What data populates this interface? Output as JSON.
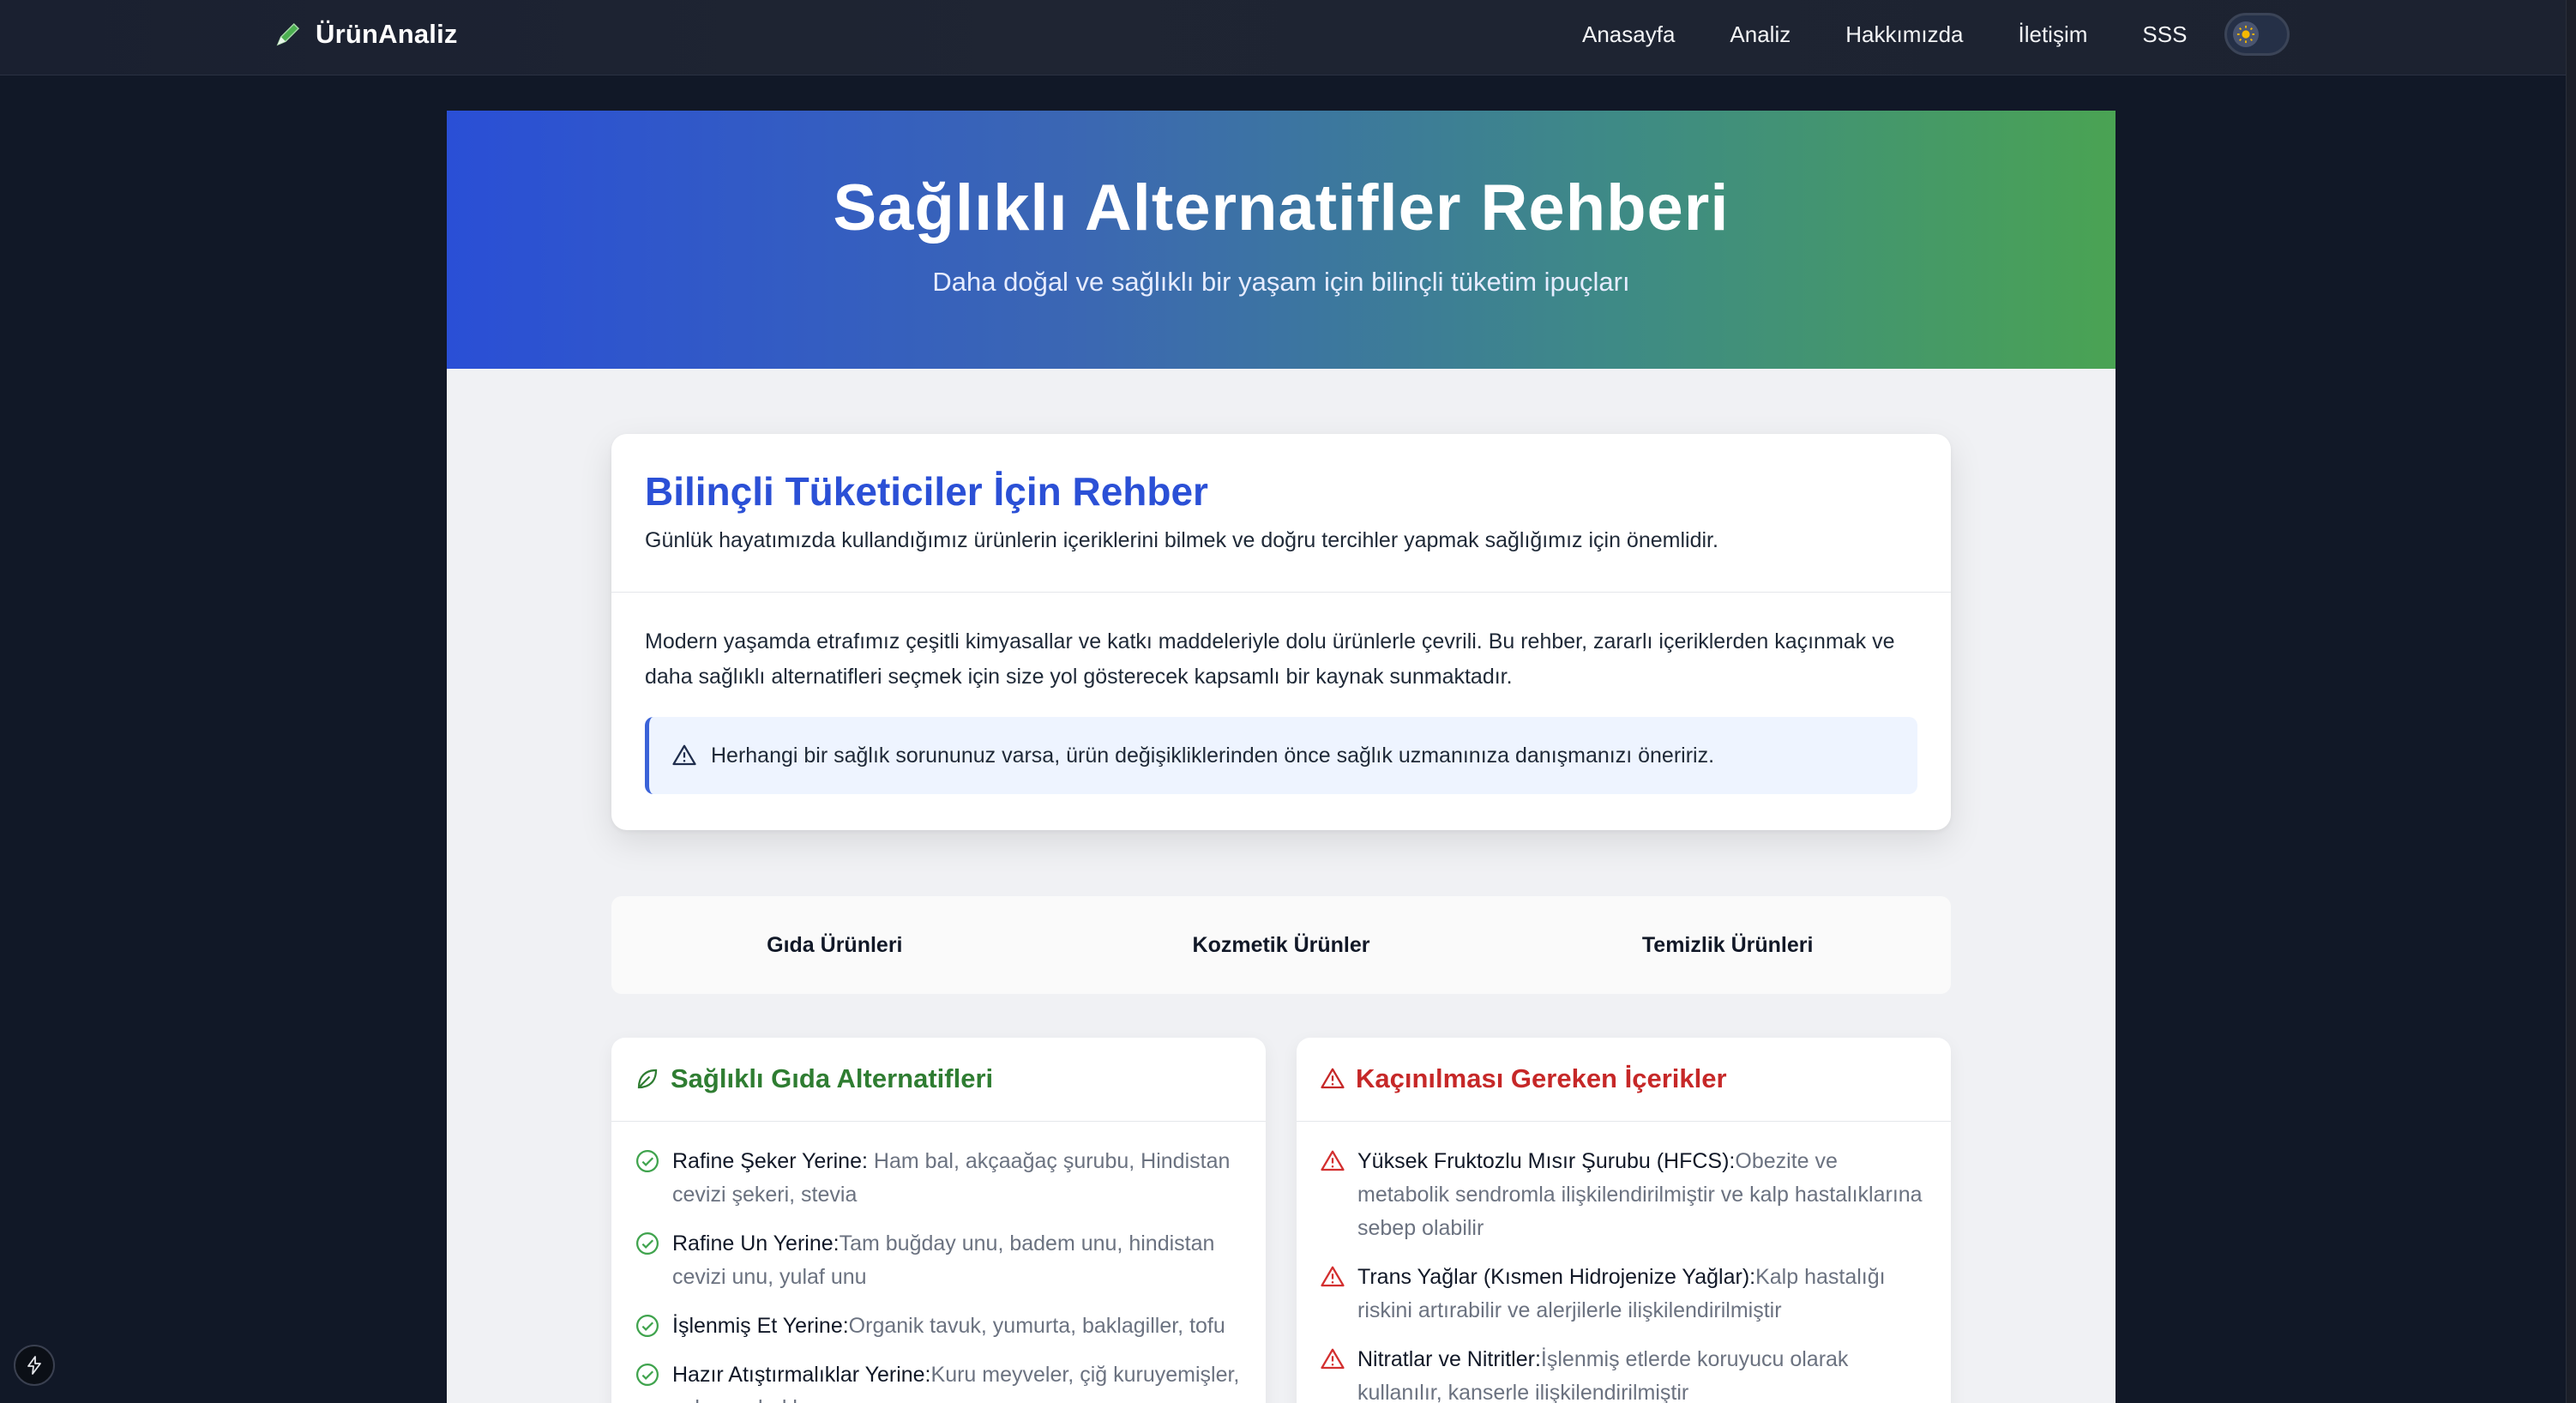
{
  "nav": {
    "brand": "ÜrünAnaliz",
    "links": [
      "Anasayfa",
      "Analiz",
      "Hakkımızda",
      "İletişim",
      "SSS"
    ],
    "brand_icon": "pencil-icon",
    "toggle_icon": "sun-icon"
  },
  "hero": {
    "title": "Sağlıklı Alternatifler Rehberi",
    "subtitle": "Daha doğal ve sağlıklı bir yaşam için bilinçli tüketim ipuçları"
  },
  "intro": {
    "title": "Bilinçli Tüketiciler İçin Rehber",
    "lead": "Günlük hayatımızda kullandığımız ürünlerin içeriklerini bilmek ve doğru tercihler yapmak sağlığımız için önemlidir.",
    "body": "Modern yaşamda etrafımız çeşitli kimyasallar ve katkı maddeleriyle dolu ürünlerle çevrili. Bu rehber, zararlı içeriklerden kaçınmak ve daha sağlıklı alternatifleri seçmek için size yol gösterecek kapsamlı bir kaynak sunmaktadır.",
    "notice": "Herhangi bir sağlık sorununuz varsa, ürün değişikliklerinden önce sağlık uzmanınıza danışmanızı öneririz."
  },
  "tabs": [
    "Gıda Ürünleri",
    "Kozmetik Ürünler",
    "Temizlik Ürünleri"
  ],
  "healthy": {
    "title": "Sağlıklı Gıda Alternatifleri",
    "items": [
      {
        "label": "Rafine Şeker Yerine:",
        "desc": " Ham bal, akçaağaç şurubu, Hindistan cevizi şekeri, stevia"
      },
      {
        "label": "Rafine Un Yerine:",
        "desc": "Tam buğday unu, badem unu, hindistan cevizi unu, yulaf unu"
      },
      {
        "label": "İşlenmiş Et Yerine:",
        "desc": "Organik tavuk, yumurta, baklagiller, tofu"
      },
      {
        "label": "Hazır Atıştırmalıklar Yerine:",
        "desc": "Kuru meyveler, çiğ kuruyemişler, sebze çubukları"
      }
    ]
  },
  "avoid": {
    "title": "Kaçınılması Gereken İçerikler",
    "items": [
      {
        "label": "Yüksek Fruktozlu Mısır Şurubu (HFCS):",
        "desc": "Obezite ve metabolik sendromla ilişkilendirilmiştir ve kalp hastalıklarına sebep olabilir"
      },
      {
        "label": "Trans Yağlar (Kısmen Hidrojenize Yağlar):",
        "desc": "Kalp hastalığı riskini artırabilir ve alerjilerle ilişkilendirilmiştir"
      },
      {
        "label": "Nitratlar ve Nitritler:",
        "desc": "İşlenmiş etlerde koruyucu olarak kullanılır, kanserle ilişkilendirilmiştir"
      }
    ]
  },
  "colors": {
    "accent": "#2b50d6",
    "healthy": "#2f7d32",
    "danger": "#c62828"
  }
}
